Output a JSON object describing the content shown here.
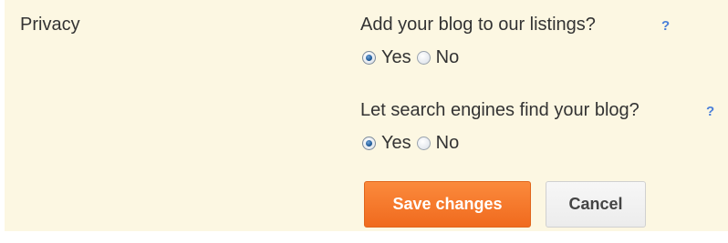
{
  "section": {
    "label": "Privacy"
  },
  "listing": {
    "question": "Add your blog to our listings?",
    "help": "?",
    "selected": "Yes",
    "options": [
      {
        "label": "Yes",
        "checked": true
      },
      {
        "label": "No",
        "checked": false
      }
    ]
  },
  "search": {
    "question": "Let search engines find your blog?",
    "help": "?",
    "selected": "Yes",
    "options": [
      {
        "label": "Yes",
        "checked": true
      },
      {
        "label": "No",
        "checked": false
      }
    ]
  },
  "actions": {
    "save_label": "Save changes",
    "cancel_label": "Cancel"
  },
  "colors": {
    "panel_background": "#fcf7e2",
    "save_button": "#f47b2a",
    "help_link": "#4a7fd9"
  }
}
